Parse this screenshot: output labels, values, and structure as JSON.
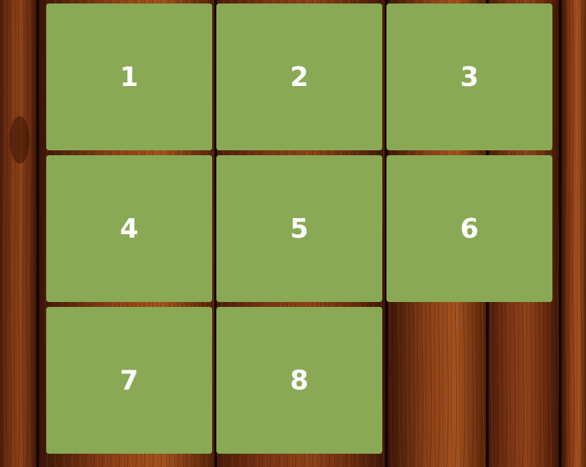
{
  "game": {
    "type": "8-puzzle",
    "tile_color": "#89a955",
    "label_color": "#ffffff",
    "background": "wood-planks",
    "tiles": [
      {
        "label": "1"
      },
      {
        "label": "2"
      },
      {
        "label": "3"
      },
      {
        "label": "4"
      },
      {
        "label": "5"
      },
      {
        "label": "6"
      },
      {
        "label": "7"
      },
      {
        "label": "8"
      },
      {
        "label": null
      }
    ]
  }
}
